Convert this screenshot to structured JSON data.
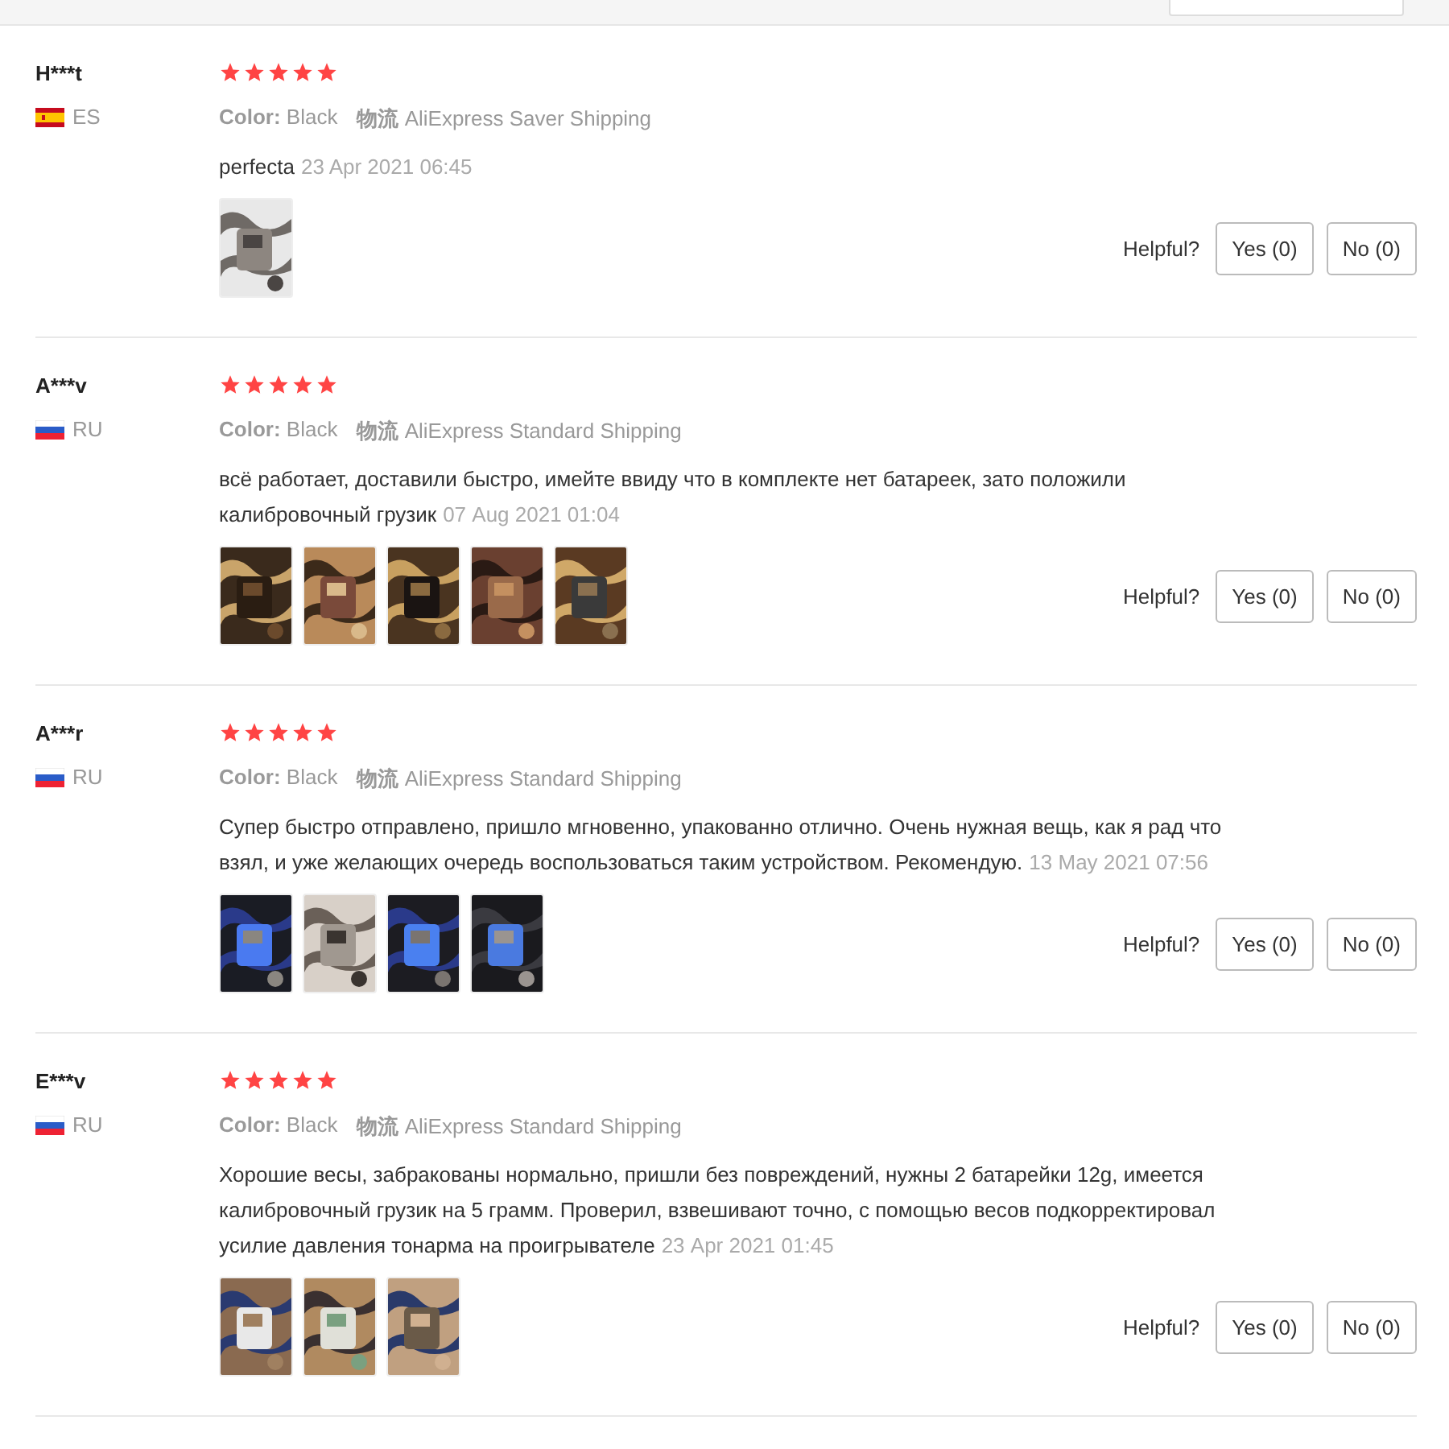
{
  "reviews": [
    {
      "name": "H***t",
      "country": {
        "kind": "spain",
        "code": "ES"
      },
      "stars": 5,
      "color_label": "Color:",
      "color_value": "Black",
      "shipping_label": "物流",
      "shipping": "AliExpress Saver Shipping",
      "text": "perfecta",
      "date": "23 Apr 2021 06:45",
      "photos": [
        {
          "kind": "picture"
        }
      ],
      "helpful_label": "Helpful?",
      "yes": "Yes (0)",
      "no": "No (0)"
    },
    {
      "name": "A***v",
      "country": {
        "kind": "russia",
        "code": "RU"
      },
      "stars": 5,
      "color_label": "Color:",
      "color_value": "Black",
      "shipping_label": "物流",
      "shipping": "AliExpress Standard Shipping",
      "text": "всё работает, доставили быстро, имейте ввиду что в комплекте нет батареек, зато положили калибровочный грузик",
      "date": "07 Aug 2021 01:04",
      "photos": [
        {
          "kind": "picture"
        },
        {
          "kind": "picture"
        },
        {
          "kind": "picture"
        },
        {
          "kind": "picture"
        },
        {
          "kind": "picture"
        }
      ],
      "helpful_label": "Helpful?",
      "yes": "Yes (0)",
      "no": "No (0)"
    },
    {
      "name": "A***r",
      "country": {
        "kind": "russia",
        "code": "RU"
      },
      "stars": 5,
      "color_label": "Color:",
      "color_value": "Black",
      "shipping_label": "物流",
      "shipping": "AliExpress Standard Shipping",
      "text": "Супер быстро отправлено, пришло мгновенно, упакованно отлично. Очень нужная вещь, как я рад что взял, и уже желающих очередь воспользоваться таким устройством. Рекомендую.",
      "date": "13 May 2021 07:56",
      "photos": [
        {
          "kind": "picture"
        },
        {
          "kind": "picture"
        },
        {
          "kind": "picture"
        },
        {
          "kind": "picture"
        }
      ],
      "helpful_label": "Helpful?",
      "yes": "Yes (0)",
      "no": "No (0)"
    },
    {
      "name": "E***v",
      "country": {
        "kind": "russia",
        "code": "RU"
      },
      "stars": 5,
      "color_label": "Color:",
      "color_value": "Black",
      "shipping_label": "物流",
      "shipping": "AliExpress Standard Shipping",
      "text": "Хорошие весы, забракованы нормально, пришли без повреждений, нужны 2 батарейки 12g, имеется калибровочный грузик на 5 грамм. Проверил, взвешивают точно, с помощью весов подкорректировал усилие давления тонарма на проигрывателе",
      "date": "23 Apr 2021 01:45",
      "photos": [
        {
          "kind": "picture"
        },
        {
          "kind": "picture"
        },
        {
          "kind": "picture"
        }
      ],
      "helpful_label": "Helpful?",
      "yes": "Yes (0)",
      "no": "No (0)"
    }
  ]
}
